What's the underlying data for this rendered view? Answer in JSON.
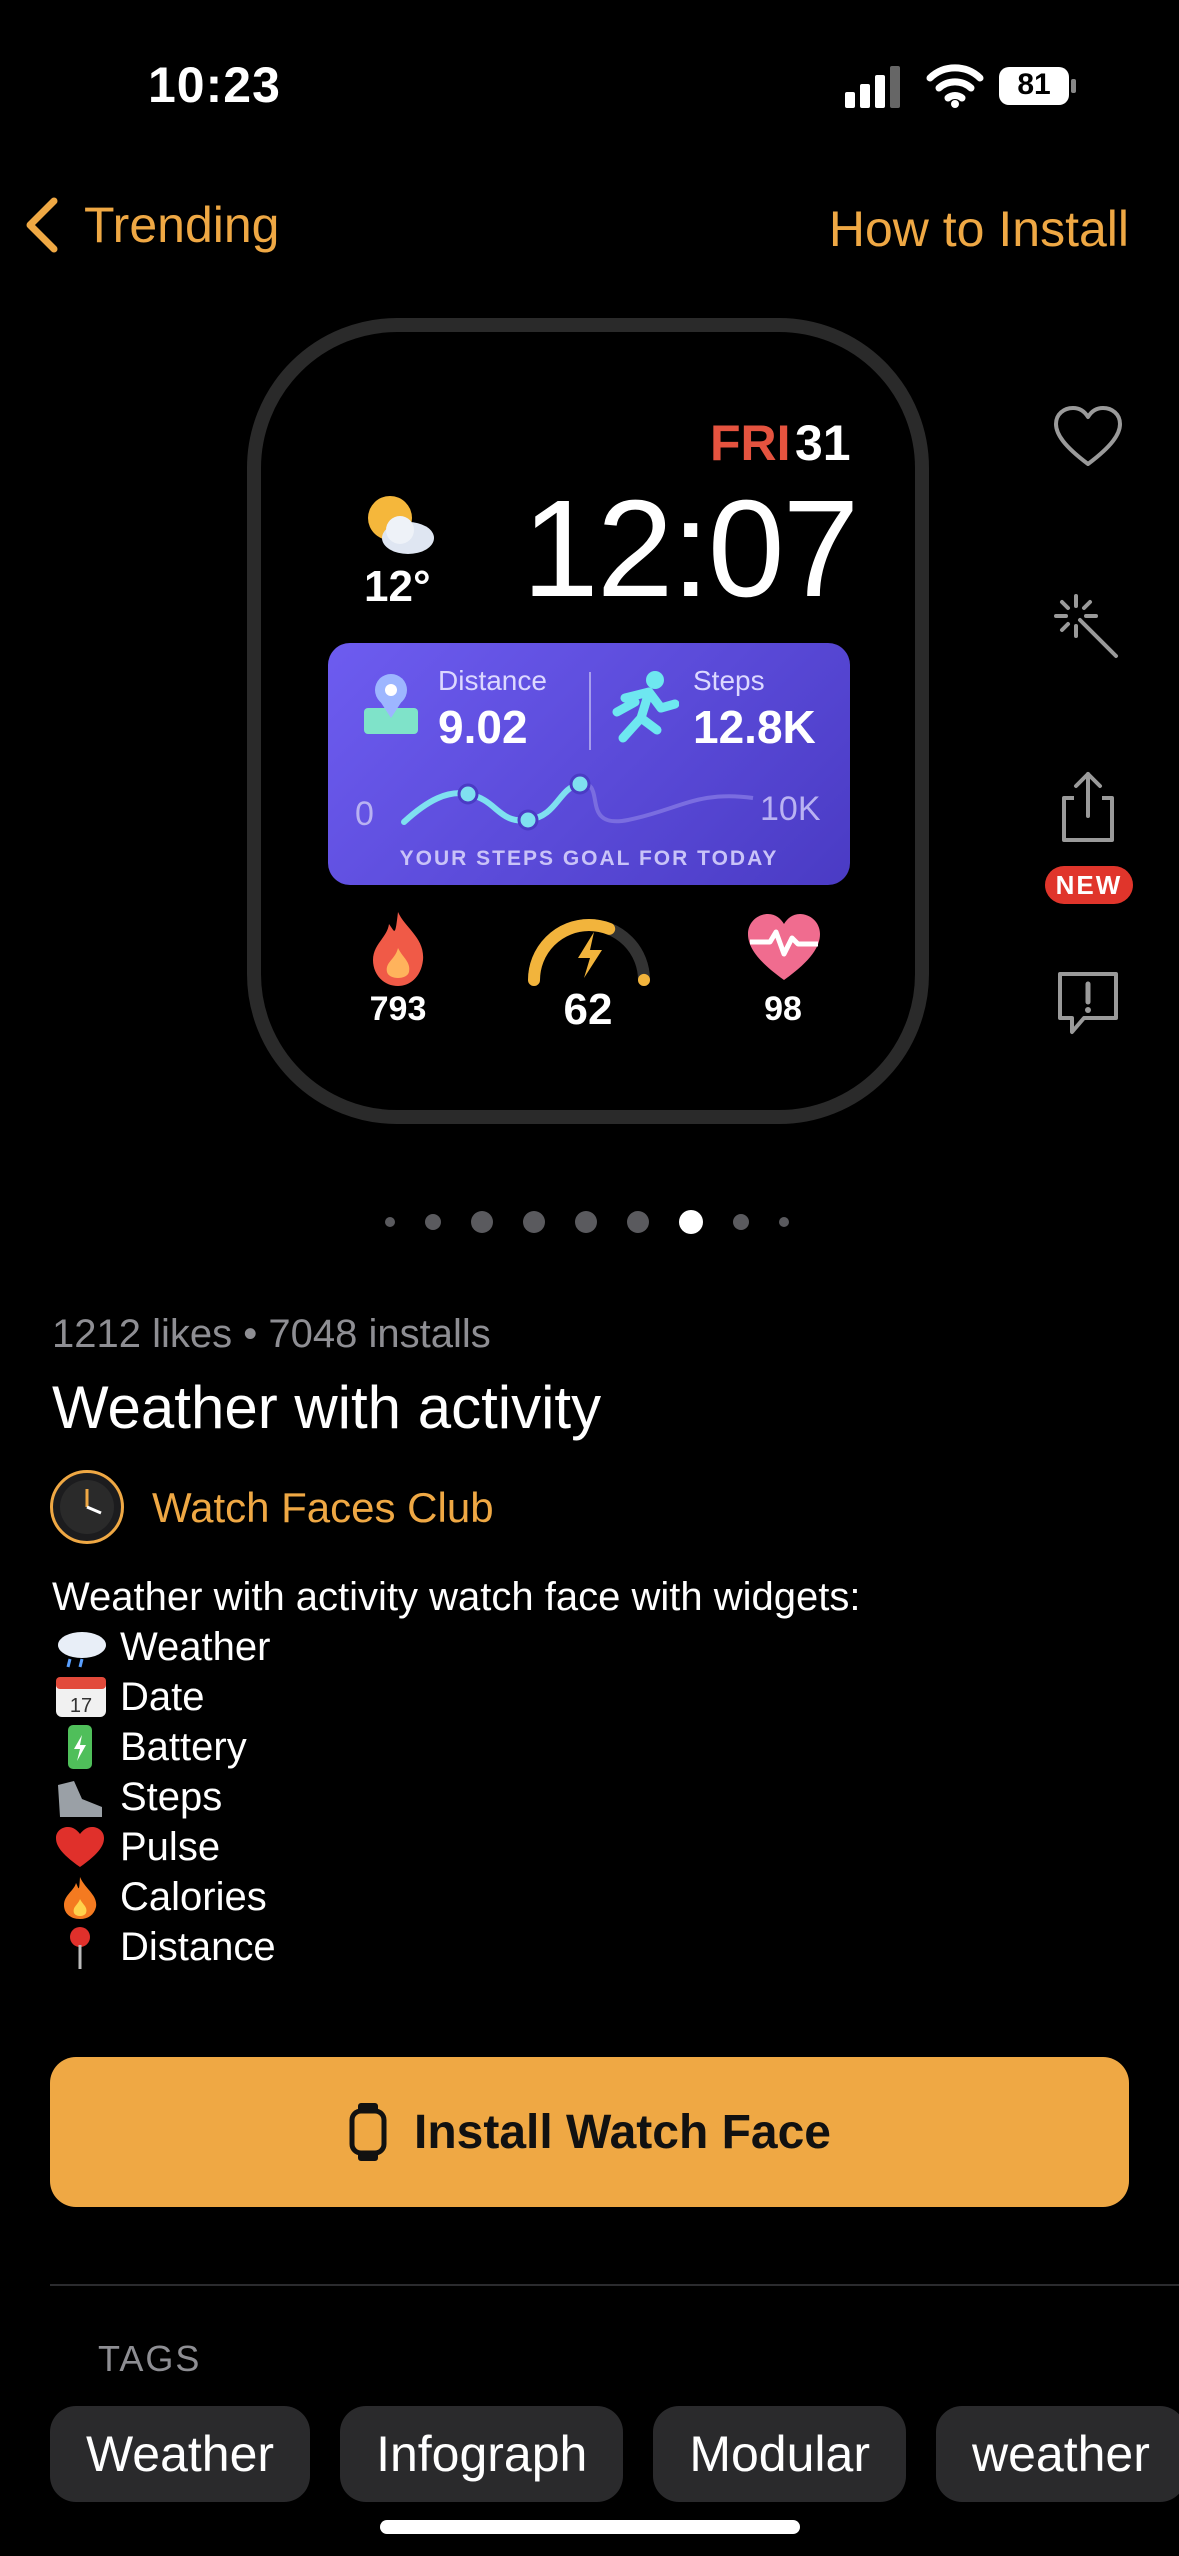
{
  "status": {
    "time": "10:23",
    "battery": "81"
  },
  "nav": {
    "back_label": "Trending",
    "right_label": "How to Install"
  },
  "watch_face": {
    "day": "FRI",
    "day_number": "31",
    "time": "12:07",
    "temperature": "12°",
    "distance_label": "Distance",
    "distance_value": "9.02",
    "steps_label": "Steps",
    "steps_value": "12.8K",
    "range_start": "0",
    "range_end": "10K",
    "goal_text": "YOUR STEPS GOAL FOR TODAY",
    "calories": "793",
    "battery": "62",
    "pulse": "98"
  },
  "side_actions": {
    "new_badge": "NEW"
  },
  "carousel": {
    "page_count": 9,
    "active_index": 6
  },
  "info": {
    "meta": "1212 likes • 7048 installs",
    "title": "Weather with activity",
    "author": "Watch Faces Club",
    "description": "Weather with activity watch face with widgets:",
    "features": [
      {
        "icon": "cloud-rain-icon",
        "label": "Weather"
      },
      {
        "icon": "calendar-icon",
        "label": "Date"
      },
      {
        "icon": "battery-icon",
        "label": "Battery"
      },
      {
        "icon": "shoe-icon",
        "label": "Steps"
      },
      {
        "icon": "heart-icon",
        "label": "Pulse"
      },
      {
        "icon": "flame-icon",
        "label": "Calories"
      },
      {
        "icon": "pin-icon",
        "label": "Distance"
      }
    ]
  },
  "install_button": {
    "label": "Install Watch Face"
  },
  "tags": {
    "title": "TAGS",
    "items": [
      "Weather",
      "Infograph",
      "Modular",
      "weather"
    ]
  },
  "colors": {
    "accent": "#EFA844",
    "card": "#5B4BDB",
    "danger": "#E0352B"
  }
}
